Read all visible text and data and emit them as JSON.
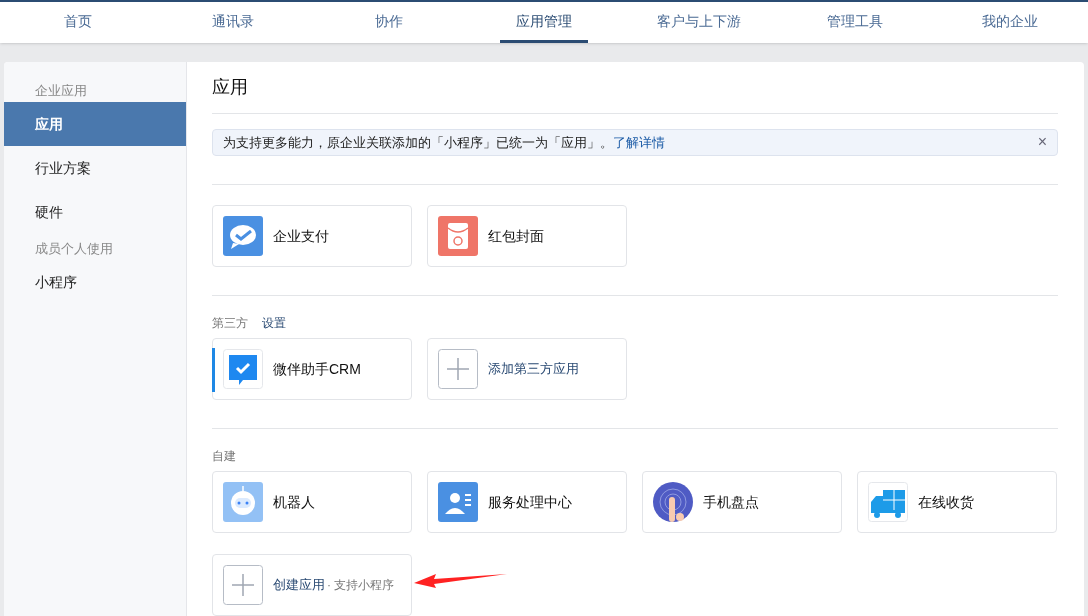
{
  "nav": [
    {
      "label": "首页",
      "selected": false
    },
    {
      "label": "通讯录",
      "selected": false
    },
    {
      "label": "协作",
      "selected": false
    },
    {
      "label": "应用管理",
      "selected": true
    },
    {
      "label": "客户与上下游",
      "selected": false
    },
    {
      "label": "管理工具",
      "selected": false
    },
    {
      "label": "我的企业",
      "selected": false
    }
  ],
  "sidebar": [
    {
      "kind": "heading",
      "label": "企业应用"
    },
    {
      "kind": "item",
      "label": "应用",
      "selected": true
    },
    {
      "kind": "item",
      "label": "行业方案",
      "selected": false
    },
    {
      "kind": "item",
      "label": "硬件",
      "selected": false
    },
    {
      "kind": "heading",
      "label": "成员个人使用"
    },
    {
      "kind": "item",
      "label": "小程序",
      "selected": false
    }
  ],
  "title": "应用",
  "notice": {
    "text": "为支持更多能力，原企业关联添加的「小程序」已统一为「应用」。",
    "link": "了解详情",
    "close": "×"
  },
  "sections": [
    {
      "cards": [
        {
          "kind": "app",
          "label": "企业支付",
          "marked": false
        },
        {
          "kind": "app",
          "label": "红包封面",
          "marked": false
        }
      ]
    },
    {
      "title": "第三方",
      "action": "设置",
      "cards": [
        {
          "kind": "app",
          "label": "微伴助手CRM",
          "marked": true
        },
        {
          "kind": "add",
          "label": "添加第三方应用"
        }
      ]
    },
    {
      "title": "自建",
      "cards": [
        {
          "kind": "app",
          "label": "机器人",
          "marked": false
        },
        {
          "kind": "app",
          "label": "服务处理中心",
          "marked": false
        },
        {
          "kind": "app",
          "label": "手机盘点",
          "marked": false
        },
        {
          "kind": "app",
          "label": "在线收货",
          "marked": false
        },
        {
          "kind": "add",
          "label": "创建应用",
          "note": "· 支持小程序"
        }
      ]
    }
  ]
}
